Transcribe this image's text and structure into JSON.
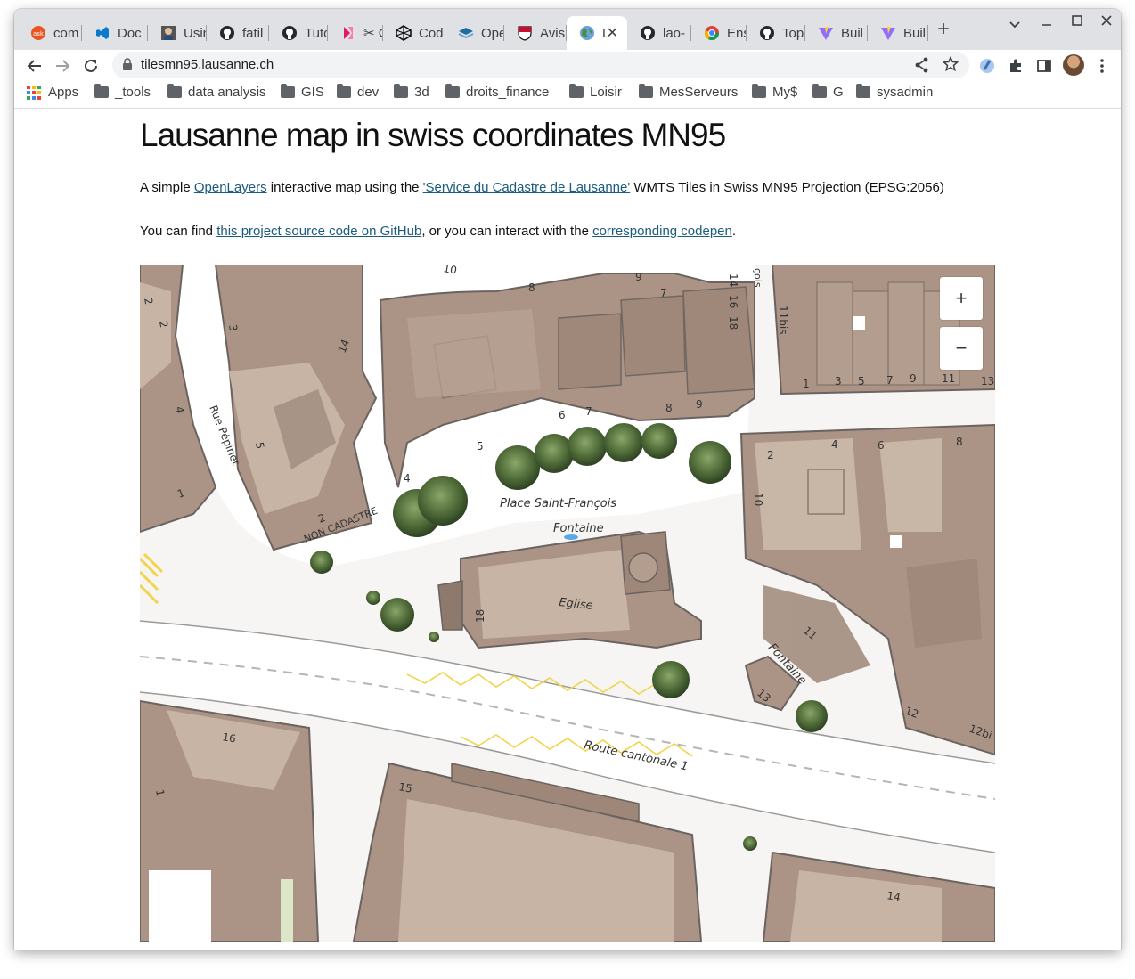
{
  "browser": {
    "tabs": [
      {
        "label": "com",
        "icon": "askubuntu-icon",
        "color": "#e95420"
      },
      {
        "label": "Doc",
        "icon": "vscode-icon",
        "color": "#0a7acc"
      },
      {
        "label": "Usin",
        "icon": "profile-icon",
        "color": "#444444"
      },
      {
        "label": "fatil",
        "icon": "github-icon",
        "color": "#24292f"
      },
      {
        "label": "Tuto",
        "icon": "github-icon",
        "color": "#24292f"
      },
      {
        "label": "✂ Co",
        "icon": "kanban-icon",
        "color": "#e5195f"
      },
      {
        "label": "Cod",
        "icon": "codepen-icon",
        "color": "#111111"
      },
      {
        "label": "Ope",
        "icon": "openlayers-icon",
        "color": "#1f6b9f"
      },
      {
        "label": "Avis",
        "icon": "shield-icon",
        "color": "#c8102e"
      },
      {
        "label": "L",
        "icon": "globe-icon",
        "color": "#4a8f3c",
        "active": true
      },
      {
        "label": "lao-",
        "icon": "github-icon",
        "color": "#24292f"
      },
      {
        "label": "Ens",
        "icon": "chrome-icon",
        "color": "#4285f4"
      },
      {
        "label": "Top",
        "icon": "github-icon",
        "color": "#24292f"
      },
      {
        "label": "Buil",
        "icon": "vite-icon",
        "color": "#8f6dff"
      },
      {
        "label": "Buil",
        "icon": "vite-icon",
        "color": "#8f6dff"
      }
    ],
    "new_tab": "+",
    "url": "tilesmn95.lausanne.ch",
    "bookmarks": [
      "Apps",
      "_tools",
      "data analysis",
      "GIS",
      "dev",
      "3d",
      "droits_finance",
      "Loisir",
      "MesServeurs",
      "My$",
      "G",
      "sysadmin"
    ]
  },
  "page": {
    "title": "Lausanne map in swiss coordinates MN95",
    "intro": {
      "before": "A simple ",
      "link1": "OpenLayers",
      "middle": " interactive map using the ",
      "link2": "'Service du Cadastre de Lausanne'",
      "after": " WMTS Tiles in Swiss MN95 Projection (EPSG:2056)"
    },
    "source": {
      "before": "You can find ",
      "link1": "this project source code on GitHub",
      "middle": ", or you can interact with the ",
      "link2": "corresponding codepen",
      "after": "."
    }
  },
  "map": {
    "zoom_in": "+",
    "zoom_out": "−",
    "labels": {
      "place": "Place Saint-François",
      "fontaine1": "Fontaine",
      "eglise": "Eglise",
      "rue": "Rue Pépinet",
      "non_cadastre": "NON CADASTRE",
      "route": "Route cantonale 1",
      "fontaine2": "Fontaine",
      "cois": "çois"
    },
    "numbers": {
      "n2a": "2",
      "n2b": "2",
      "n3": "3",
      "n4a": "4",
      "n14a": "14",
      "n5a": "5",
      "n1a": "1",
      "n2c": "2",
      "n10a": "10",
      "n8a": "8",
      "n9a": "9",
      "n7a": "7",
      "n14b": "14",
      "n16": "16",
      "n18a": "18",
      "n11bis": "11bis",
      "n1b": "1",
      "n3b": "3",
      "n5b": "5",
      "n7b": "7",
      "n9b": "9",
      "n11": "11",
      "n13": "13",
      "n6": "6",
      "n7c": "7",
      "n8b": "8",
      "n9c": "9",
      "n5c": "5",
      "n4b": "4",
      "n2d": "2",
      "n4c": "4",
      "n6b": "6",
      "n8c": "8",
      "n10b": "10",
      "n18b": "18",
      "n11b": "11",
      "n13b": "13",
      "n12": "12",
      "n12bis": "12bi",
      "n16b": "16",
      "n1c": "1",
      "n15": "15",
      "n14c": "14"
    }
  }
}
